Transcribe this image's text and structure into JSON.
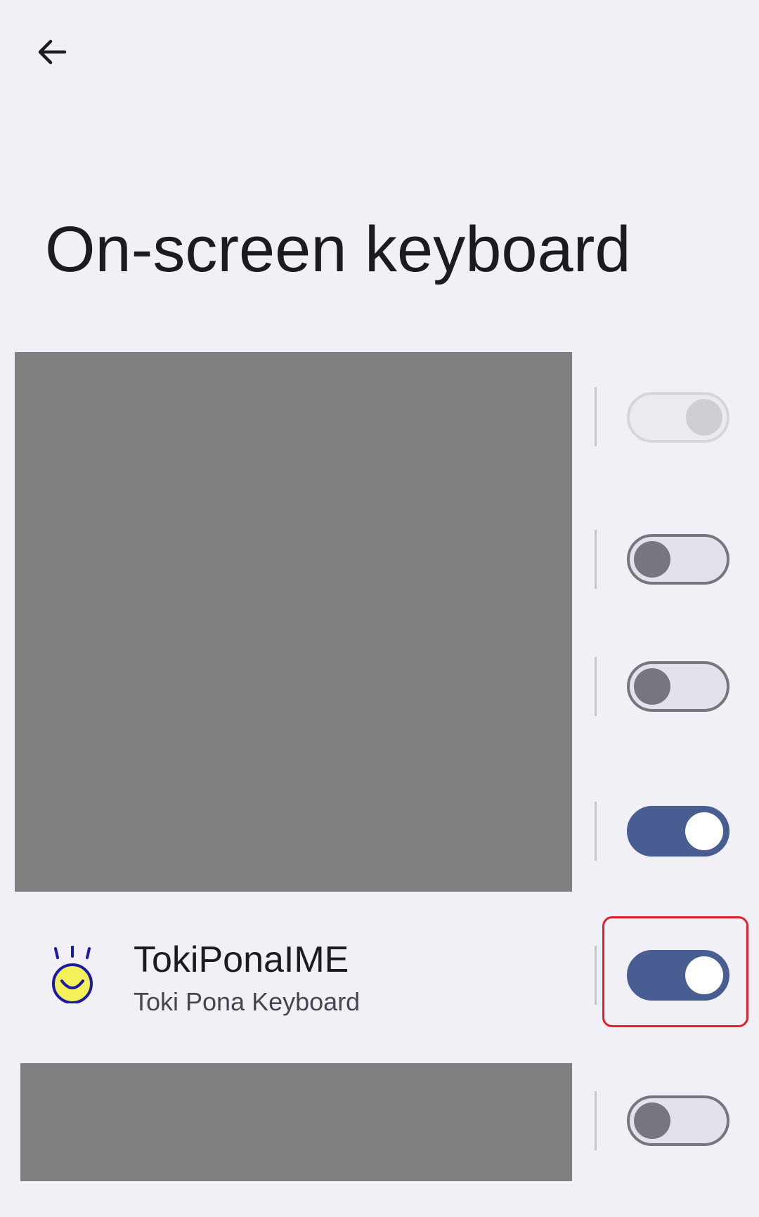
{
  "header": {
    "back_icon": "arrow-back-icon",
    "title": "On-screen keyboard"
  },
  "keyboards": [
    {
      "label": "",
      "state": "on",
      "enabled": false
    },
    {
      "label": "",
      "state": "off",
      "enabled": true
    },
    {
      "label": "",
      "state": "off",
      "enabled": true
    },
    {
      "label": "",
      "state": "on",
      "enabled": true
    },
    {
      "label": "TokiPonaIME",
      "subtitle": "Toki Pona Keyboard",
      "icon": "toki-pona-smiley-icon",
      "state": "on",
      "enabled": true,
      "highlighted": true
    },
    {
      "label": "",
      "state": "off",
      "enabled": true
    }
  ],
  "colors": {
    "background": "#f1f0f7",
    "switch_on_track": "#485e92",
    "switch_off_thumb": "#767680",
    "highlight": "#e5202a",
    "redaction": "#808080"
  }
}
